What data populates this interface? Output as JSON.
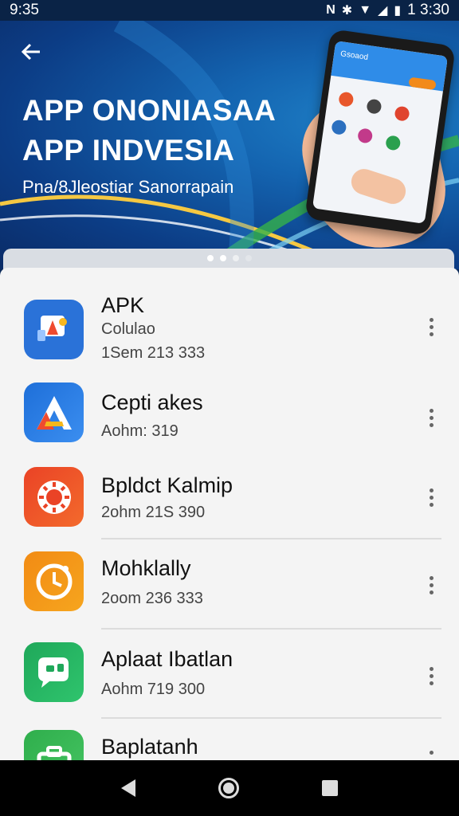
{
  "status_bar": {
    "time_left": "9:35",
    "time_right": "1 3:30",
    "icons": [
      "nfc-icon",
      "bluetooth-icon",
      "wifi-icon",
      "signal-icon",
      "battery-icon"
    ]
  },
  "hero": {
    "back_icon": "arrow-left-icon",
    "title_line1": "APP ONONIASAA",
    "title_line2": "APP INDVESIA",
    "subtitle": "Pna/8Jleostiar Sanorrapain",
    "phone_header": "Gsoaod",
    "carousel": {
      "count": 4,
      "active": 1
    }
  },
  "apps": [
    {
      "name": "APK",
      "line1": "Colulao",
      "line2": "1Sem 213 333",
      "icon": "app-icon-apk",
      "color": "#2a72d8"
    },
    {
      "name": "Cepti akes",
      "line1": "Aohm: 319",
      "icon": "app-icon-letter-a",
      "color": "#1e6fd9"
    },
    {
      "name": "Bpldct Kalmip",
      "line1": "2ohm 21S 390",
      "icon": "app-icon-sun",
      "color": "#ea4326"
    },
    {
      "name": "Mohklally",
      "line1": "2oom 236 333",
      "icon": "app-icon-clock",
      "color": "#f28b14"
    },
    {
      "name": "Aplaat Ibatlan",
      "line1": "Aohm 719 300",
      "icon": "app-icon-chat",
      "color": "#1fa85a"
    },
    {
      "name": "Baplatanh",
      "line1": "",
      "icon": "app-icon-briefcase",
      "color": "#2fae4c"
    }
  ],
  "nav": {
    "back_icon": "nav-back-icon",
    "home_icon": "nav-home-icon",
    "recents_icon": "nav-recents-icon"
  }
}
